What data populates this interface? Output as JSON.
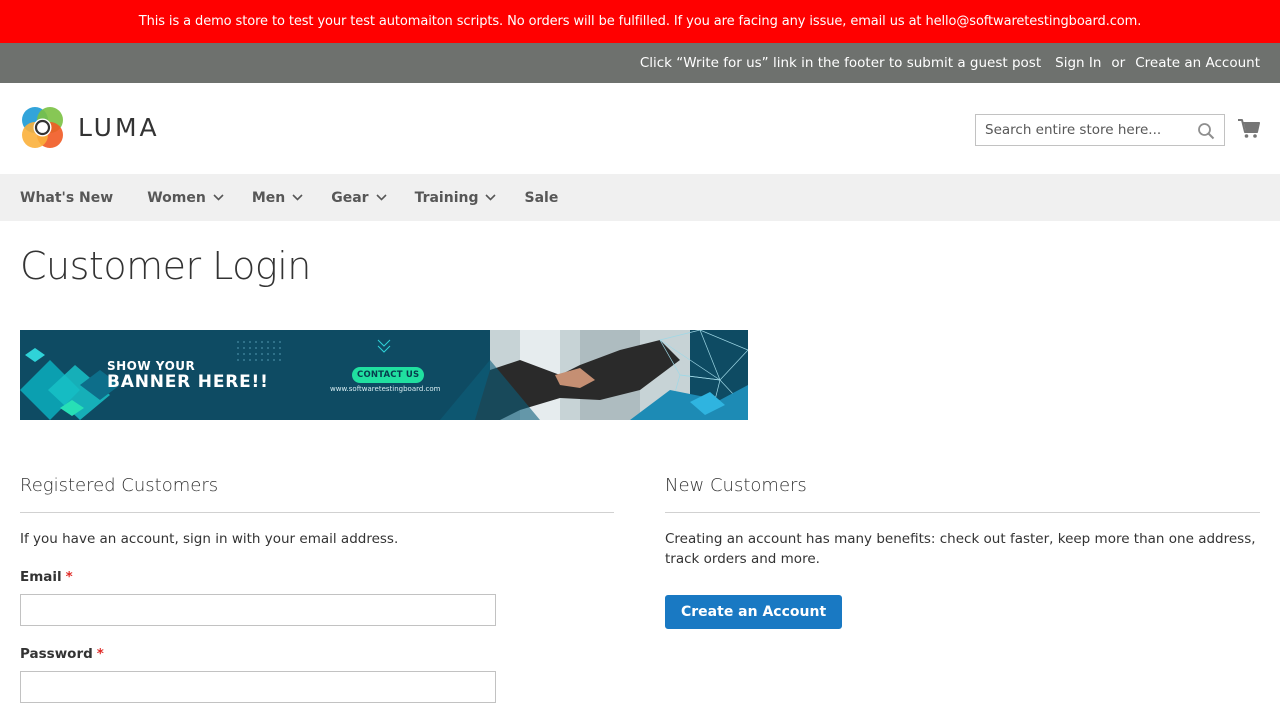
{
  "demo_notice": "This is a demo store to test your test automaiton scripts. No orders will be fulfilled. If you are facing any issue, email us at hello@softwaretestingboard.com.",
  "top_bar": {
    "guest_post": "Click “Write for us” link in the footer to submit a guest post",
    "sign_in": "Sign In",
    "or": "or",
    "create_account": "Create an Account"
  },
  "header": {
    "logo_text": "LUMA",
    "search_placeholder": "Search entire store here...",
    "icons": {
      "search": "search-icon",
      "cart": "cart-icon"
    }
  },
  "nav": {
    "items": [
      {
        "label": "What's New",
        "has_dropdown": false
      },
      {
        "label": "Women",
        "has_dropdown": true
      },
      {
        "label": "Men",
        "has_dropdown": true
      },
      {
        "label": "Gear",
        "has_dropdown": true
      },
      {
        "label": "Training",
        "has_dropdown": true
      },
      {
        "label": "Sale",
        "has_dropdown": false
      }
    ]
  },
  "page_title": "Customer Login",
  "promo_banner": {
    "line1": "SHOW YOUR",
    "line2": "BANNER HERE!!",
    "cta": "CONTACT US",
    "url": "www.softwaretestingboard.com"
  },
  "registered": {
    "heading": "Registered Customers",
    "intro": "If you have an account, sign in with your email address.",
    "email_label": "Email",
    "password_label": "Password",
    "required_mark": "*",
    "email_value": "",
    "password_value": ""
  },
  "new_customers": {
    "heading": "New Customers",
    "text": "Creating an account has many benefits: check out faster, keep more than one address, track orders and more.",
    "button": "Create an Account"
  },
  "colors": {
    "demo_banner": "#ff0000",
    "top_bar": "#6e716e",
    "nav_bg": "#f0f0f0",
    "primary_button": "#1979c3",
    "required": "#e02b27"
  }
}
